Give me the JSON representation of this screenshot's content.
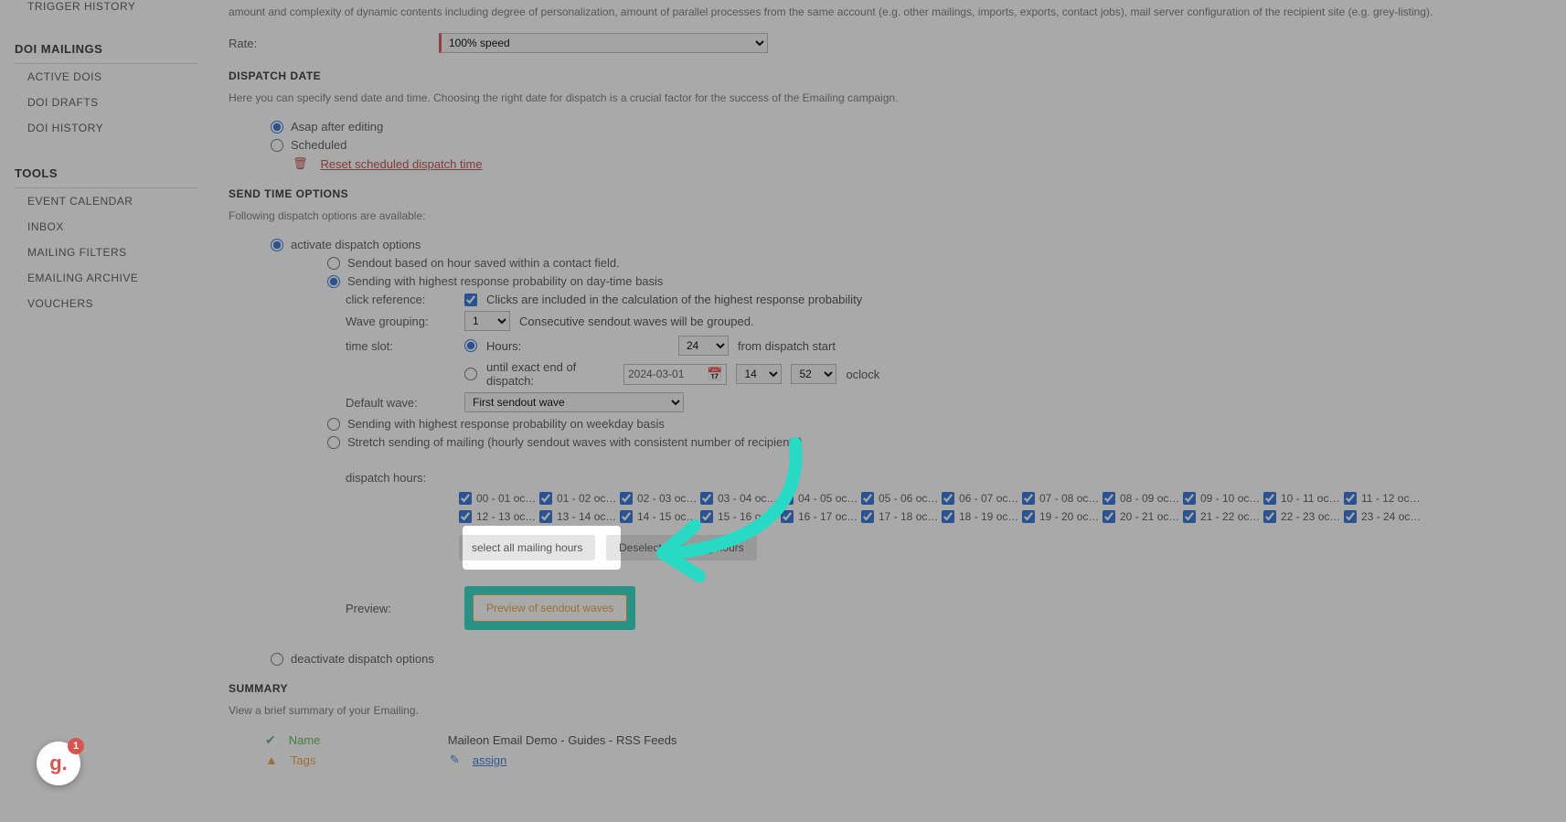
{
  "sidebar": {
    "top": "TRIGGER HISTORY",
    "section1": {
      "title": "DOI MAILINGS",
      "items": [
        "ACTIVE DOIS",
        "DOI DRAFTS",
        "DOI HISTORY"
      ]
    },
    "section2": {
      "title": "TOOLS",
      "items": [
        "EVENT CALENDAR",
        "INBOX",
        "MAILING FILTERS",
        "EMAILING ARCHIVE",
        "VOUCHERS"
      ]
    }
  },
  "rate": {
    "label": "Rate:",
    "value": "100% speed",
    "desc": "amount and complexity of dynamic contents including degree of personalization, amount of parallel processes from the same account (e.g. other mailings, imports, exports, contact jobs), mail server configuration of the recipient site (e.g. grey-listing)."
  },
  "dispatch_date": {
    "heading": "DISPATCH DATE",
    "desc": "Here you can specify send date and time. Choosing the right date for dispatch is a crucial factor for the success of the Emailing campaign.",
    "opt1": "Asap after editing",
    "opt2": "Scheduled",
    "reset": "Reset scheduled dispatch time"
  },
  "send_time": {
    "heading": "SEND TIME OPTIONS",
    "desc": "Following dispatch options are available:",
    "activate": "activate dispatch options",
    "opt_a": "Sendout based on hour saved within a contact field.",
    "opt_b": "Sending with highest response probability on day-time basis",
    "opt_c": "Sending with highest response probability on weekday basis",
    "opt_d": "Stretch sending of mailing (hourly sendout waves with consistent number of recipients)",
    "click_ref_label": "click reference:",
    "click_ref_text": "Clicks are included in the calculation of the highest response probability",
    "wave_label": "Wave grouping:",
    "wave_value": "1",
    "wave_text": "Consecutive sendout waves will be grouped.",
    "timeslot_label": "time slot:",
    "hours_radio": "Hours:",
    "hours_value": "24",
    "hours_suffix": "from dispatch start",
    "until_radio": "until exact end of dispatch:",
    "until_date": "2024-03-01",
    "until_h": "14",
    "until_m": "52",
    "oclock": "oclock",
    "default_wave_label": "Default wave:",
    "default_wave_value": "First sendout wave",
    "dispatch_hours_label": "dispatch hours:",
    "hours": [
      "00 - 01 oc…",
      "01 - 02 oc…",
      "02 - 03 oc…",
      "03 - 04 oc…",
      "04 - 05 oc…",
      "05 - 06 oc…",
      "06 - 07 oc…",
      "07 - 08 oc…",
      "08 - 09 oc…",
      "09 - 10 oc…",
      "10 - 11 oc…",
      "11 - 12 oc…",
      "12 - 13 oc…",
      "13 - 14 oc…",
      "14 - 15 oc…",
      "15 - 16 oc…",
      "16 - 17 oc…",
      "17 - 18 oc…",
      "18 - 19 oc…",
      "19 - 20 oc…",
      "20 - 21 oc…",
      "21 - 22 oc…",
      "22 - 23 oc…",
      "23 - 24 oc…"
    ],
    "select_all": "select all mailing hours",
    "deselect_all": "Deselect all mailing hours",
    "preview_label": "Preview:",
    "preview_btn": "Preview of sendout waves",
    "deactivate": "deactivate dispatch options"
  },
  "summary": {
    "heading": "SUMMARY",
    "desc": "View a brief summary of your Emailing.",
    "name_label": "Name",
    "name_value": "Maileon Email Demo - Guides - RSS Feeds",
    "tags_label": "Tags",
    "tags_link": "assign"
  },
  "avatar": {
    "letter": "g.",
    "count": "1"
  }
}
